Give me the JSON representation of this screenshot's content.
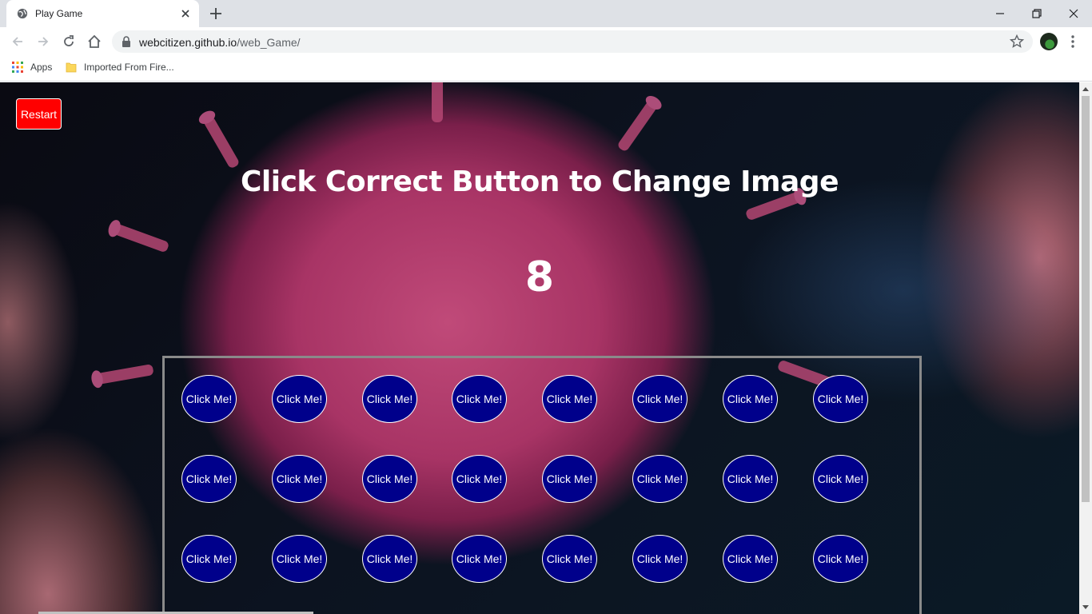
{
  "browser": {
    "tab_title": "Play Game",
    "url_host": "webcitizen.github.io",
    "url_path": "/web_Game/",
    "bookmarks": [
      {
        "label": "Apps"
      },
      {
        "label": "Imported From Fire..."
      }
    ]
  },
  "game": {
    "restart_label": "Restart",
    "headline": "Click Correct Button to Change Image",
    "counter": "8",
    "button_label": "Click Me!",
    "rows": 3,
    "cols": 8,
    "colors": {
      "restart_bg": "#ff0000",
      "button_bg": "#00008b",
      "board_border": "#8a8a8a"
    }
  }
}
